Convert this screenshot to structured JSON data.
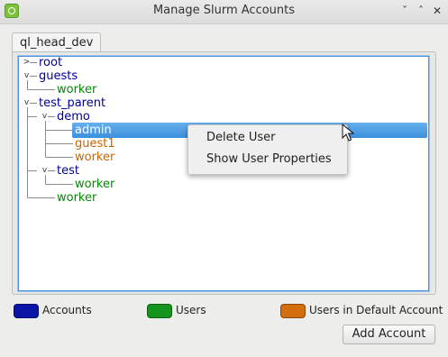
{
  "window": {
    "title": "Manage Slurm Accounts",
    "buttons": [
      "ˇ",
      "ˆ",
      "✕"
    ]
  },
  "tab": {
    "label": "ql_head_dev"
  },
  "tree": {
    "items": [
      {
        "label": "root",
        "kind": "account"
      },
      {
        "label": "guests",
        "kind": "account"
      },
      {
        "label": "worker",
        "kind": "user"
      },
      {
        "label": "test_parent",
        "kind": "account"
      },
      {
        "label": "demo",
        "kind": "account"
      },
      {
        "label": "admin",
        "kind": "user-default",
        "selected": true
      },
      {
        "label": "guest1",
        "kind": "user-default"
      },
      {
        "label": "worker",
        "kind": "user-default"
      },
      {
        "label": "test",
        "kind": "account"
      },
      {
        "label": "worker",
        "kind": "user"
      },
      {
        "label": "worker",
        "kind": "user"
      }
    ]
  },
  "context_menu": {
    "items": [
      "Delete User",
      "Show User Properties"
    ]
  },
  "legend": {
    "accounts": {
      "label": "Accounts",
      "color": "#0a14a6"
    },
    "users": {
      "label": "Users",
      "color": "#14961e"
    },
    "default": {
      "label": "Users in Default Account",
      "color": "#d46d10"
    }
  },
  "colors": {
    "account_text": "#000096",
    "user_text": "#008a00",
    "default_text": "#c86600",
    "selection": "#3b8fdc"
  },
  "add_button": {
    "label": "Add Account"
  }
}
